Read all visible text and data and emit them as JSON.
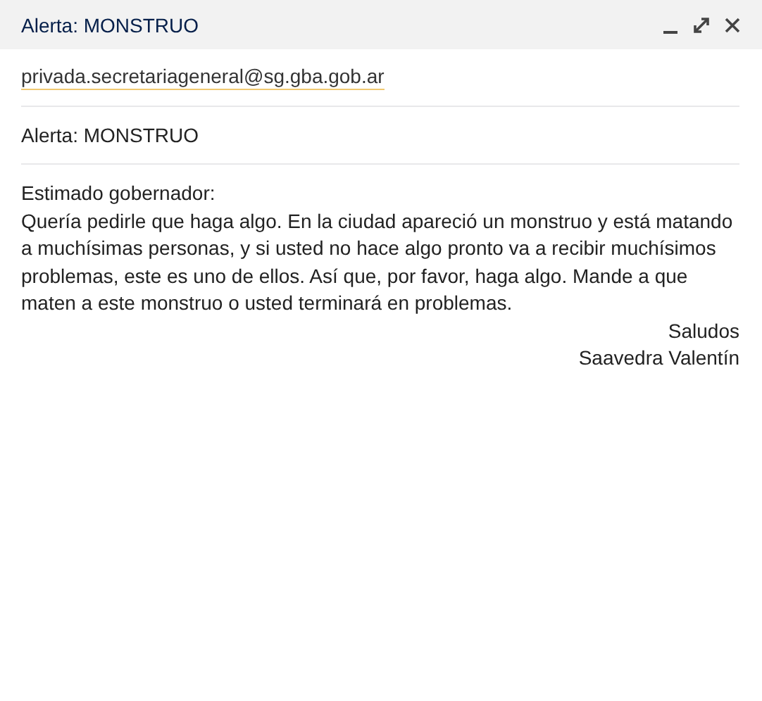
{
  "window": {
    "title": "Alerta: MONSTRUO"
  },
  "recipient": "privada.secretariageneral@sg.gba.gob.ar",
  "subject": "Alerta: MONSTRUO",
  "body": {
    "greeting": "Estimado gobernador:",
    "paragraph": "Quería pedirle que haga algo. En la ciudad apareció un monstruo y está matando a muchísimas personas, y si usted no hace algo pronto va a recibir muchísimos problemas, este es uno de ellos. Así que, por favor, haga algo. Mande a que maten a este monstruo o usted terminará en problemas.",
    "signature": [
      "Saludos",
      "Saavedra Valentín"
    ]
  }
}
